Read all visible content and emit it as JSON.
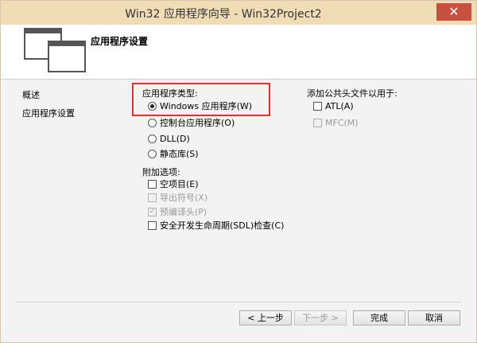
{
  "window": {
    "title": "Win32 应用程序向导 - Win32Project2",
    "close_glyph": "✕"
  },
  "header": {
    "title": "应用程序设置"
  },
  "nav": {
    "items": [
      "概述",
      "应用程序设置"
    ]
  },
  "app_type": {
    "label": "应用程序类型:",
    "options": [
      "Windows 应用程序(W)",
      "控制台应用程序(O)",
      "DLL(D)",
      "静态库(S)"
    ],
    "selected_index": 0
  },
  "additional": {
    "label": "附加选项:",
    "options": [
      {
        "label": "空项目(E)",
        "checked": false,
        "enabled": true
      },
      {
        "label": "导出符号(X)",
        "checked": false,
        "enabled": false
      },
      {
        "label": "预编译头(P)",
        "checked": true,
        "enabled": false
      },
      {
        "label": "安全开发生命周期(SDL)检查(C)",
        "checked": false,
        "enabled": true
      }
    ]
  },
  "common_headers": {
    "label": "添加公共头文件以用于:",
    "options": [
      {
        "label": "ATL(A)",
        "checked": false,
        "enabled": true
      },
      {
        "label": "MFC(M)",
        "checked": false,
        "enabled": false
      }
    ]
  },
  "buttons": {
    "prev": "< 上一步",
    "next": "下一步 >",
    "finish": "完成",
    "cancel": "取消"
  },
  "colors": {
    "titlebar": "#f0ddb5",
    "close": "#c7503f",
    "highlight": "#e2322d"
  }
}
